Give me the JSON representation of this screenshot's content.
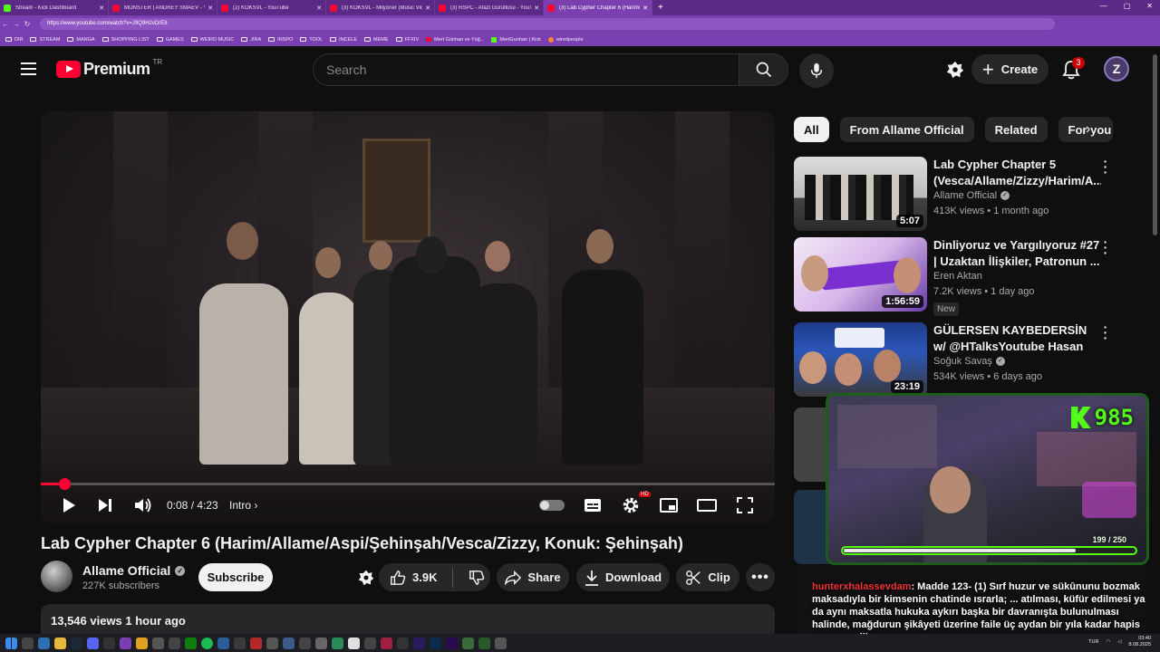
{
  "browser": {
    "tabs": [
      {
        "label": "Stream - Kick Dashboard",
        "color": "#53fc18"
      },
      {
        "label": "MONSTER | ANDREY SMAEV - Yo",
        "color": "#ff0033"
      },
      {
        "label": "(2) KÖKSVL - YouTube",
        "color": "#ff0033"
      },
      {
        "label": "(3) KÖKSVL - Milyoner (Music Vid",
        "color": "#ff0033"
      },
      {
        "label": "(3) RSPC - Afazi Gürültüsü - YouTu",
        "color": "#ff0033"
      },
      {
        "label": "(3) Lab Cypher Chapter 6 (Harim/",
        "color": "#ff0033"
      }
    ],
    "new_tab": "+",
    "url": "https://www.youtube.com/watch?v=J9Q9H2vDrE8",
    "bookmarks": [
      "DIR",
      "STREAM",
      "MANGA",
      "SHOPPING LIST",
      "GAMES",
      "WEIRD MUSIC",
      "JIRA",
      "INSPO",
      "TOOL",
      "INCELE",
      "MEME",
      "FFXIV",
      "Mert Günhan ve Yüğ...",
      "MertGunhan | Kick",
      "wiredpeople"
    ]
  },
  "header": {
    "logo_text": "Premium",
    "logo_region": "TR",
    "search_placeholder": "Search",
    "create_label": "Create",
    "notification_count": "3",
    "avatar_letter": "Z"
  },
  "player": {
    "progress": 0.032,
    "time": "0:08 / 4:23",
    "chapter": "Intro",
    "hd_badge": "HD"
  },
  "video": {
    "title": "Lab Cypher Chapter 6 (Harim/Allame/Aspi/Şehinşah/Vesca/Zizzy, Konuk: Şehinşah)",
    "channel": "Allame Official",
    "subscribers": "227K subscribers",
    "subscribe_label": "Subscribe",
    "likes": "3.9K",
    "share_label": "Share",
    "download_label": "Download",
    "clip_label": "Clip",
    "views_date": "13,546 views  1 hour ago"
  },
  "chips": [
    "All",
    "From Allame Official",
    "Related",
    "For you"
  ],
  "recommendations": [
    {
      "title": "Lab Cypher Chapter 5 (Vesca/Allame/Zizzy/Harim/A...",
      "channel": "Allame Official",
      "verified": true,
      "meta": "413K views • 1 month ago",
      "duration": "5:07",
      "new": ""
    },
    {
      "title": "Dinliyoruz ve Yargılıyoruz #27 | Uzaktan İlişkiler, Patronun ...",
      "channel": "Eren Aktan",
      "verified": false,
      "meta": "7.2K views • 1 day ago",
      "duration": "1:56:59",
      "new": "New"
    },
    {
      "title": "GÜLERSEN KAYBEDERSİN w/ @HTalksYoutube Hasan Arda ...",
      "channel": "Soğuk Savaş",
      "verified": true,
      "meta": "534K views • 6 days ago",
      "duration": "23:19",
      "new": ""
    }
  ],
  "stream_overlay": {
    "kick_count": "985",
    "goal_text": "199  / 250",
    "goal_fraction": 0.796
  },
  "chat": {
    "username": "hunterxhalassevdam",
    "message": ": Madde 123- (1) Sırf huzur ve sükûnunu bozmak maksadıyla bir kimsenin chatinde ısrarla; ... atılması, küfür edilmesi ya da aynı maksatla hukuka aykırı başka bir davranışta bulunulması halinde, mağdurun şikâyeti üzerine faile üç aydan bir yıla kadar hapis cezası verilir."
  },
  "taskbar": {
    "lang": "TUR",
    "time": "03:40",
    "date": "8.08.2025"
  }
}
